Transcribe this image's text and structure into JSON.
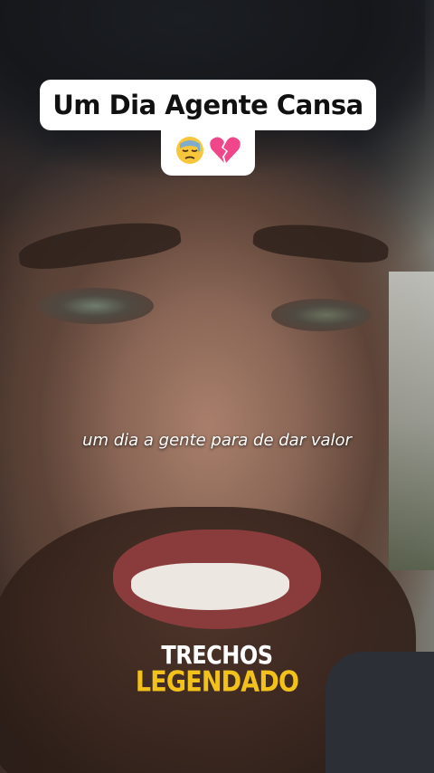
{
  "title": {
    "text": "Um Dia Agente Cansa",
    "emojis": [
      "downcast-face-with-sweat",
      "broken-heart"
    ]
  },
  "subtitle": {
    "text": "um dia a gente para de dar valor"
  },
  "watermark": {
    "line1": "TRECHOS",
    "line2": "LEGENDADO",
    "line1_color": "#ffffff",
    "line2_color": "#f2c21b"
  }
}
